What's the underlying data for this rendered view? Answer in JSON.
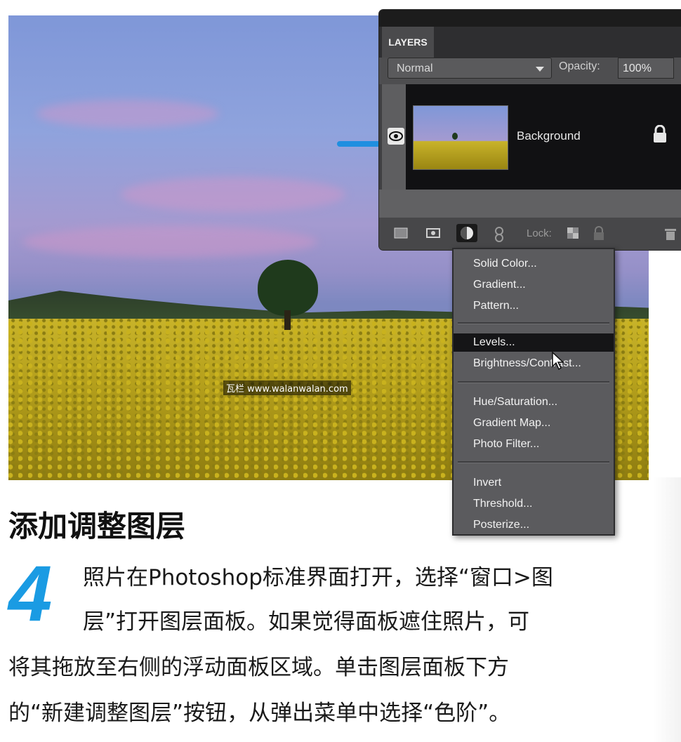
{
  "watermark": "瓦栏 www.walanwalan.com",
  "layers_panel": {
    "tab_label": "LAYERS",
    "blend_mode": "Normal",
    "opacity_label": "Opacity:",
    "opacity_value": "100%",
    "layer_name": "Background",
    "lock_label": "Lock:"
  },
  "adjustment_menu": {
    "items": [
      "Solid Color...",
      "Gradient...",
      "Pattern...",
      "Levels...",
      "Brightness/Contrast...",
      "Hue/Saturation...",
      "Gradient Map...",
      "Photo Filter...",
      "Invert",
      "Threshold...",
      "Posterize..."
    ],
    "highlighted": "Levels..."
  },
  "article": {
    "heading": "添加调整图层",
    "step_number": "4",
    "lines": [
      "照片在Photoshop标准界面打开，选择“窗口>图",
      "层”打开图层面板。如果觉得面板遮住照片，可",
      "将其拖放至右侧的浮动面板区域。单击图层面板下方",
      "的“新建调整图层”按钮，从弹出菜单中选择“色阶”。"
    ]
  },
  "colors": {
    "accent_blue": "#1a9be3",
    "panel_bg": "#4e4e50",
    "menu_bg": "#5b5b5e",
    "highlight": "#151517"
  }
}
